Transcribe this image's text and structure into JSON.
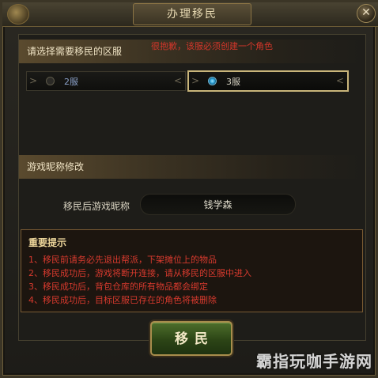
{
  "window": {
    "title": "办理移民",
    "close_symbol": "✕"
  },
  "server_section": {
    "heading": "请选择需要移民的区服",
    "warning": "很抱歉，该服必须创建一个角色",
    "servers": [
      {
        "label": "2服",
        "selected": false
      },
      {
        "label": "3服",
        "selected": true
      }
    ]
  },
  "nickname_section": {
    "heading": "游戏昵称修改",
    "field_label": "移民后游戏昵称",
    "field_value": "钱学森"
  },
  "notice": {
    "title": "重要提示",
    "lines": [
      "1、移民前请务必先退出帮派，下架摊位上的物品",
      "2、移民成功后，游戏将断开连接，请从移民的区服中进入",
      "3、移民成功后，背包仓库的所有物品都会绑定",
      "4、移民成功后，目标区服已存在的角色将被删除"
    ]
  },
  "actions": {
    "migrate_label": "移民"
  },
  "watermark": "霸指玩咖手游网",
  "colors": {
    "warning_red": "#d2362a",
    "frame_gold": "#c9b57a",
    "button_green": "#2c4516"
  }
}
